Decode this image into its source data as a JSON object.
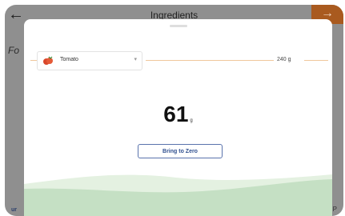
{
  "header": {
    "title": "Ingredients",
    "back_icon": "arrow-left-icon",
    "next_icon": "arrow-right-icon",
    "accent_color": "#a95a1f"
  },
  "background": {
    "partial_text": "Fo",
    "bottom_left_text": "ur",
    "bottom_right_glyph": "P"
  },
  "sheet": {
    "ingredient": {
      "selected": "Tomato",
      "icon": "tomato-icon"
    },
    "target_weight": "240 g",
    "reading": {
      "value": "61",
      "unit": "g"
    },
    "zero_button_label": "Bring to Zero",
    "colors": {
      "target_line": "#f0c79c",
      "button_border": "#5a73ad",
      "wave_light": "#e4f1e1",
      "wave_dark": "#c5e0c4"
    }
  }
}
